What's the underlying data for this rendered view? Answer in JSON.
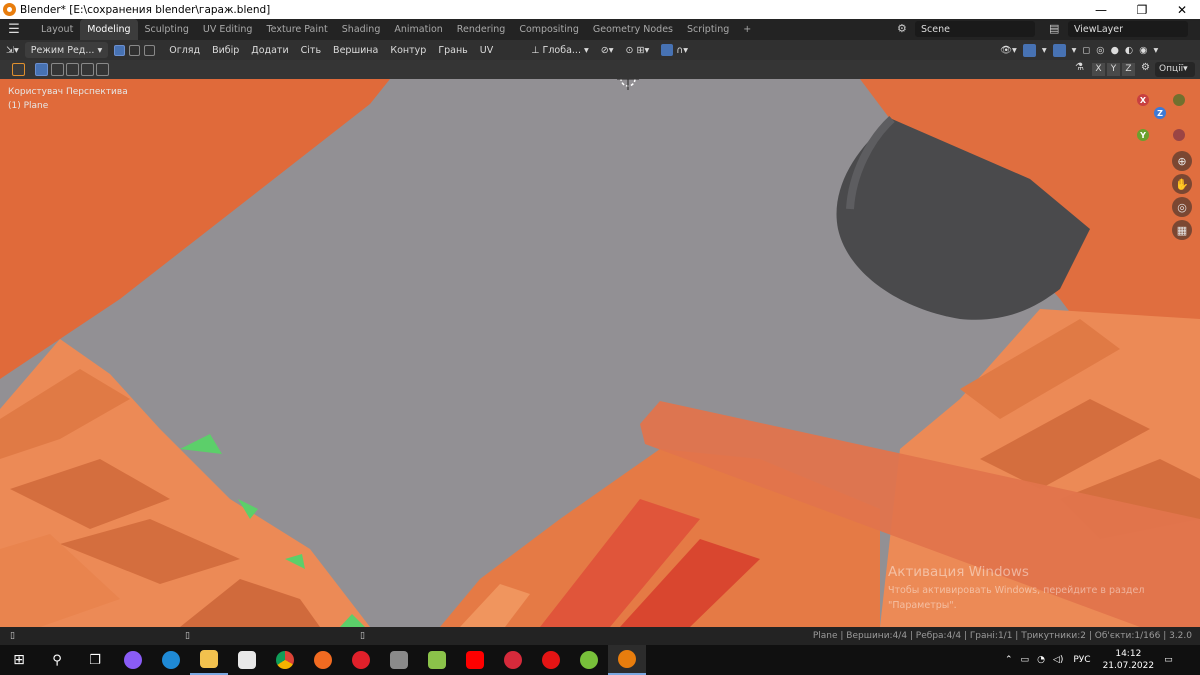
{
  "window": {
    "title": "Blender* [E:\\сохранения blender\\гараж.blend]",
    "minimize": "—",
    "maximize": "❐",
    "close": "✕"
  },
  "workspaces": {
    "tabs": [
      "Layout",
      "Modeling",
      "Sculpting",
      "UV Editing",
      "Texture Paint",
      "Shading",
      "Animation",
      "Rendering",
      "Compositing",
      "Geometry Nodes",
      "Scripting"
    ],
    "active": "Modeling",
    "add": "+"
  },
  "scene": {
    "name": "Scene",
    "view_layer": "ViewLayer"
  },
  "header": {
    "mode": "Режим Ред...",
    "menus": [
      "Огляд",
      "Вибір",
      "Додати",
      "Сіть",
      "Вершина",
      "Контур",
      "Грань",
      "UV"
    ],
    "orientation": "Глоба...",
    "options": "Опції"
  },
  "axis_toggles": [
    "X",
    "Y",
    "Z"
  ],
  "viewport": {
    "view_name": "Користувач Перспектива",
    "object": "(1) Plane",
    "gizmo": {
      "x": "X",
      "y": "Y",
      "z": "Z"
    },
    "colors": {
      "background": "#929094",
      "orange": "#e0703a",
      "green": "#5ccf6a",
      "dark_object": "#4a4a4c"
    }
  },
  "watermark": {
    "title": "Активация Windows",
    "subtitle": "Чтобы активировать Windows, перейдите в раздел",
    "subtitle2": "\"Параметры\"."
  },
  "status": {
    "text": "Plane | Вершини:4/4 | Ребра:4/4 | Грані:1/1 | Трикутники:2 | Об'єкти:1/166 | 3.2.0"
  },
  "taskbar": {
    "language": "РУС",
    "time": "14:12",
    "date": "21.07.2022",
    "apps": [
      "alice-icon",
      "edge-icon",
      "explorer-icon",
      "mail-icon",
      "chrome-icon",
      "avast-icon",
      "opera-icon",
      "winrar-icon",
      "bluestacks-icon",
      "youtube-icon",
      "opera-gx-icon",
      "youtube-music-icon",
      "utorrent-icon",
      "blender-icon"
    ]
  }
}
